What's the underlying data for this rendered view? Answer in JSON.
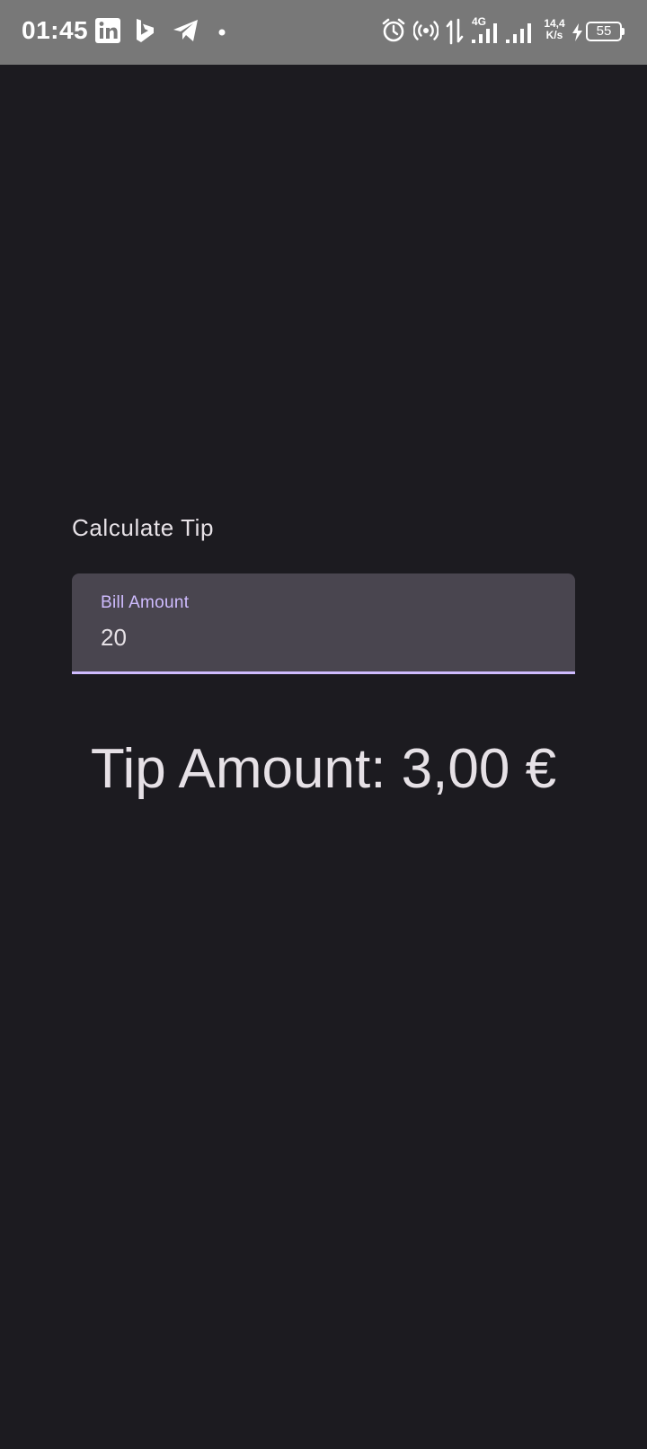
{
  "status_bar": {
    "time": "01:45",
    "network_type": "4G",
    "net_speed_value": "14,4",
    "net_speed_unit": "K/s",
    "battery_level": "55",
    "notification_icons": [
      "linkedin-icon",
      "bing-icon",
      "telegram-icon",
      "dot-icon"
    ],
    "system_icons": [
      "alarm-icon",
      "hotspot-icon",
      "data-transfer-icon",
      "signal-icon",
      "signal-icon",
      "charging-icon",
      "battery-icon"
    ]
  },
  "main": {
    "heading": "Calculate Tip",
    "bill_field": {
      "label": "Bill Amount",
      "value": "20"
    },
    "tip_result": "Tip Amount: 3,00 €"
  },
  "colors": {
    "background": "#1c1b20",
    "status_bar": "#787878",
    "field_background": "#49454f",
    "accent": "#cfbcff",
    "text": "#e6e1e6"
  }
}
